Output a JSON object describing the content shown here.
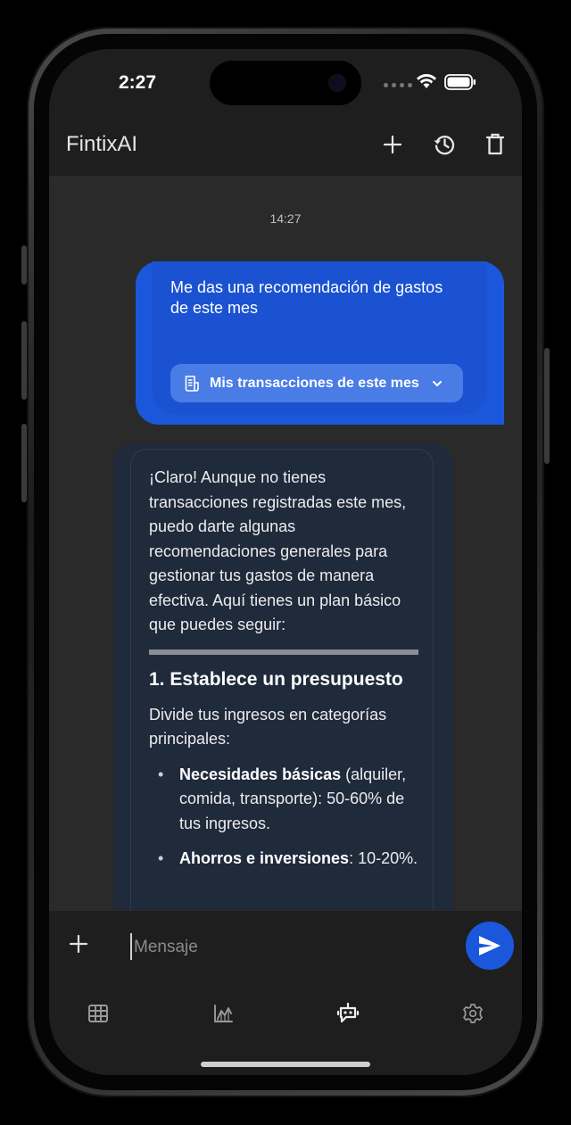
{
  "status_bar": {
    "time": "2:27"
  },
  "app_bar": {
    "title": "FintixAI",
    "icons": [
      "add-icon",
      "history-icon",
      "trash-icon"
    ]
  },
  "chat": {
    "timestamp": "14:27",
    "user_message": {
      "text": "Me das una recomendación de gastos de este mes",
      "attachment_label": "Mis transacciones de este mes"
    },
    "bot_message": {
      "intro": "¡Claro! Aunque no tienes transacciones registradas este mes, puedo darte algunas recomendaciones generales para gestionar tus gastos de manera efectiva. Aquí tienes un plan básico que puedes seguir:",
      "heading": "1. Establece un presupuesto",
      "paragraph": "Divide tus ingresos en categorías principales:",
      "bullets": [
        {
          "bold": "Necesidades básicas",
          "rest": " (alquiler, comida, transporte): 50-60% de tus ingresos."
        },
        {
          "bold": "Ahorros e inversiones",
          "rest": ": 10-20%."
        }
      ]
    }
  },
  "input": {
    "placeholder": "Mensaje"
  },
  "nav": [
    "table-icon",
    "chart-icon",
    "bot-icon",
    "settings-icon"
  ],
  "colors": {
    "accent": "#1b57db",
    "bot_bubble": "#1f2a3b",
    "background": "#2a2a2a",
    "surface": "#1e1e1e"
  }
}
